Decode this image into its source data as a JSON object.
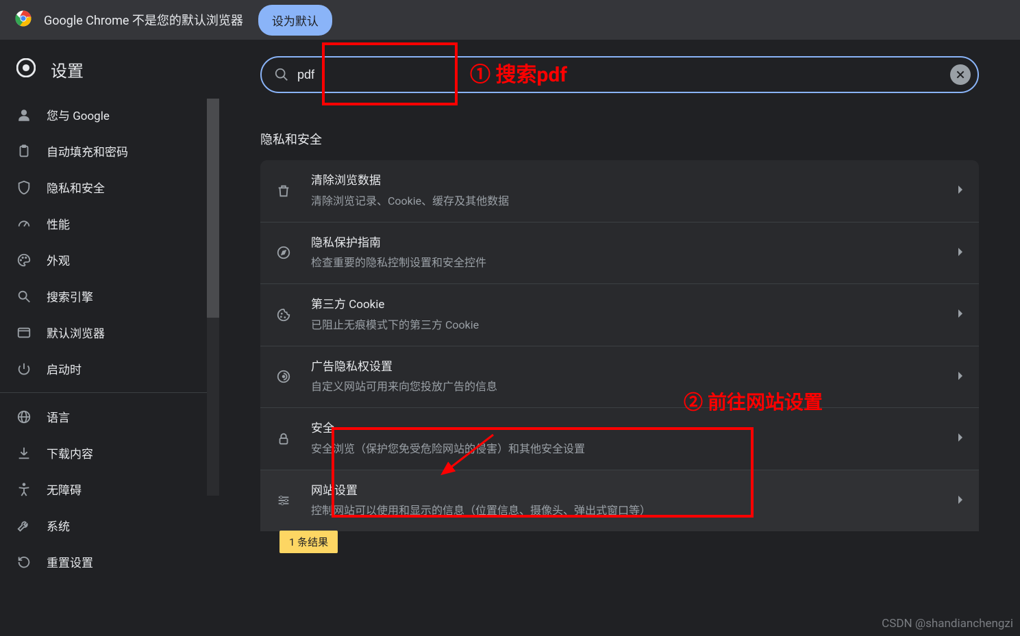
{
  "banner": {
    "text": "Google Chrome 不是您的默认浏览器",
    "button": "设为默认"
  },
  "sidebar": {
    "title": "设置",
    "items": [
      {
        "key": "you-and-google",
        "label": "您与 Google"
      },
      {
        "key": "autofill",
        "label": "自动填充和密码"
      },
      {
        "key": "privacy",
        "label": "隐私和安全"
      },
      {
        "key": "performance",
        "label": "性能"
      },
      {
        "key": "appearance",
        "label": "外观"
      },
      {
        "key": "search-engine",
        "label": "搜索引擎"
      },
      {
        "key": "default-browser",
        "label": "默认浏览器"
      },
      {
        "key": "on-startup",
        "label": "启动时"
      }
    ],
    "items2": [
      {
        "key": "languages",
        "label": "语言"
      },
      {
        "key": "downloads",
        "label": "下载内容"
      },
      {
        "key": "accessibility",
        "label": "无障碍"
      },
      {
        "key": "system",
        "label": "系统"
      },
      {
        "key": "reset",
        "label": "重置设置"
      }
    ]
  },
  "search": {
    "value": "pdf",
    "placeholder": ""
  },
  "section": {
    "title": "隐私和安全"
  },
  "rows": [
    {
      "key": "clear-data",
      "title": "清除浏览数据",
      "desc": "清除浏览记录、Cookie、缓存及其他数据"
    },
    {
      "key": "privacy-guide",
      "title": "隐私保护指南",
      "desc": "检查重要的隐私控制设置和安全控件"
    },
    {
      "key": "third-party-cookies",
      "title": "第三方 Cookie",
      "desc": "已阻止无痕模式下的第三方 Cookie"
    },
    {
      "key": "ads-privacy",
      "title": "广告隐私权设置",
      "desc": "自定义网站可用来向您投放广告的信息"
    },
    {
      "key": "security",
      "title": "安全",
      "desc": "安全浏览（保护您免受危险网站的侵害）和其他安全设置"
    },
    {
      "key": "site-settings",
      "title": "网站设置",
      "desc": "控制网站可以使用和显示的信息（位置信息、摄像头、弹出式窗口等）"
    }
  ],
  "result_chip": "1 条结果",
  "annotations": {
    "step1": "① 搜索pdf",
    "step2": "② 前往网站设置"
  },
  "watermark": "CSDN @shandianchengzi"
}
